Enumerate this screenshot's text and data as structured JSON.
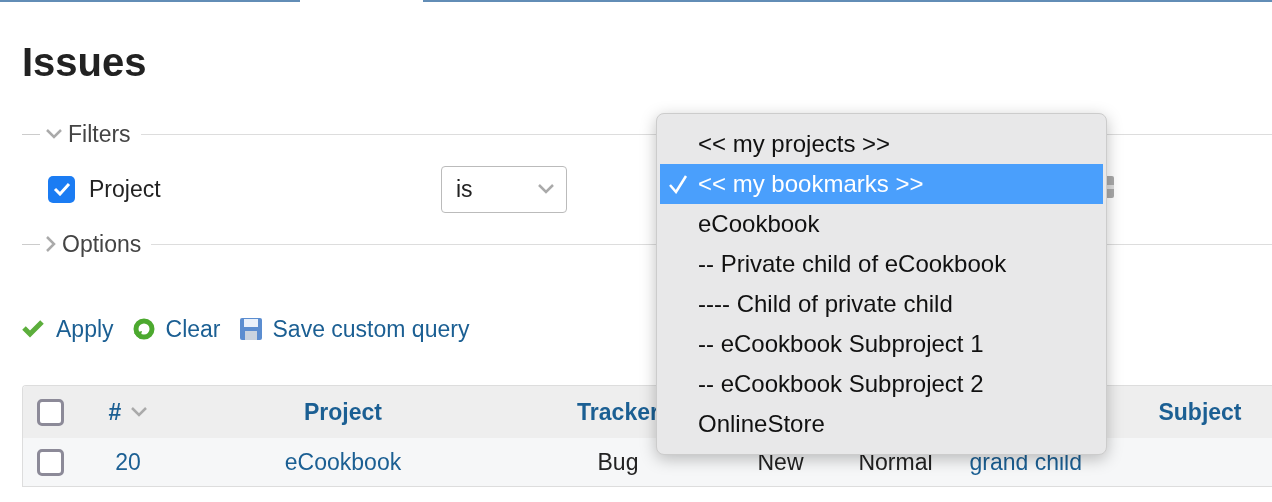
{
  "page": {
    "title": "Issues"
  },
  "filters": {
    "label": "Filters",
    "expanded": true,
    "rows": [
      {
        "label": "Project",
        "checked": true,
        "operator": "is"
      }
    ]
  },
  "options": {
    "label": "Options",
    "expanded": false
  },
  "actions": [
    {
      "label": "Apply",
      "kind": "apply"
    },
    {
      "label": "Clear",
      "kind": "clear"
    },
    {
      "label": "Save custom query",
      "kind": "save"
    }
  ],
  "table": {
    "all_selected": false,
    "columns": [
      {
        "label": "#",
        "sorted": true
      },
      {
        "label": "Project",
        "sorted": false
      },
      {
        "label": "Tracker",
        "sorted": false
      },
      {
        "label": "Subject",
        "sorted": false
      }
    ],
    "rows": [
      {
        "id": "20",
        "project": "eCookbook",
        "tracker": "Bug",
        "status": "New",
        "priority": "Normal",
        "subject": "grand child",
        "selected": false
      }
    ]
  },
  "dropdown": {
    "items": [
      {
        "label": "<< my projects >>",
        "selected": false
      },
      {
        "label": "<< my bookmarks >>",
        "selected": true
      },
      {
        "label": "eCookbook",
        "selected": false
      },
      {
        "label": "-- Private child of eCookbook",
        "selected": false
      },
      {
        "label": "---- Child of private child",
        "selected": false
      },
      {
        "label": "-- eCookbook Subproject 1",
        "selected": false
      },
      {
        "label": "-- eCookbook Subproject 2",
        "selected": false
      },
      {
        "label": "OnlineStore",
        "selected": false
      }
    ]
  }
}
